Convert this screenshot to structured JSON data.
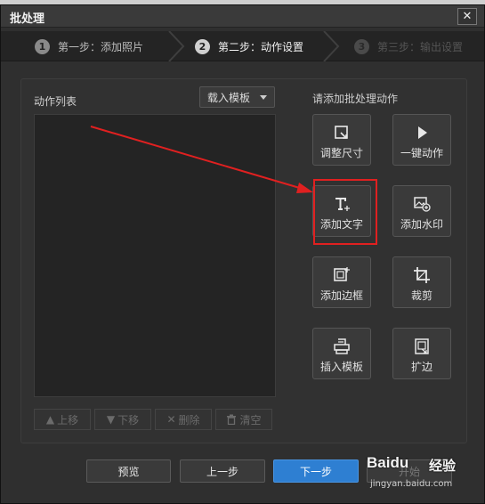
{
  "window": {
    "title": "批处理",
    "close_glyph": "✕"
  },
  "steps": [
    {
      "num": "1",
      "label": "第一步：添加照片"
    },
    {
      "num": "2",
      "label": "第二步：动作设置"
    },
    {
      "num": "3",
      "label": "第三步：输出设置"
    }
  ],
  "left": {
    "list_label": "动作列表",
    "template_dropdown": "载入模板",
    "buttons": [
      {
        "icon": "arrow-up-icon",
        "glyph": "🡅",
        "label": "上移"
      },
      {
        "icon": "arrow-down-icon",
        "glyph": "🡇",
        "label": "下移"
      },
      {
        "icon": "x-icon",
        "glyph": "✕",
        "label": "删除"
      },
      {
        "icon": "trash-icon",
        "glyph": "🗑",
        "label": "清空"
      }
    ]
  },
  "right": {
    "add_label": "请添加批处理动作",
    "actions": [
      {
        "icon": "resize-icon",
        "label": "调整尺寸"
      },
      {
        "icon": "play-icon",
        "label": "一键动作"
      },
      {
        "icon": "text-icon",
        "label": "添加文字"
      },
      {
        "icon": "watermark-icon",
        "label": "添加水印"
      },
      {
        "icon": "border-icon",
        "label": "添加边框"
      },
      {
        "icon": "crop-icon",
        "label": "裁剪"
      },
      {
        "icon": "template-icon",
        "label": "插入模板"
      },
      {
        "icon": "expand-icon",
        "label": "扩边"
      }
    ]
  },
  "footer": {
    "preview": "预览",
    "prev": "上一步",
    "next": "下一步",
    "start": "开始"
  },
  "watermark": {
    "logo": "Baidu",
    "brand": "经验",
    "url": "jingyan.baidu.com"
  },
  "colors": {
    "accent": "#2e7fd2",
    "highlight_box": "#e02020",
    "annotation_arrow": "#e02020"
  }
}
